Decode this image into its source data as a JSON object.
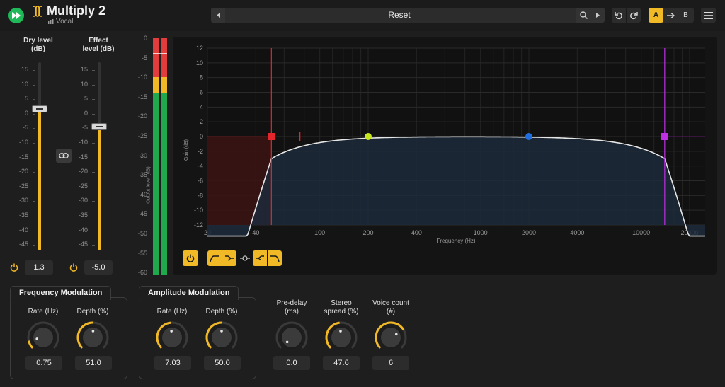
{
  "app": {
    "title": "Multiply 2",
    "preset_tag": "Vocal"
  },
  "preset": {
    "name": "Reset"
  },
  "ab": {
    "a_label": "A",
    "b_label": "B"
  },
  "levels": {
    "dry_title_1": "Dry level",
    "dry_title_2": "(dB)",
    "effect_title_1": "Effect",
    "effect_title_2": "level (dB)",
    "dry_value": "1.3",
    "effect_value": "-5.0",
    "ticks": [
      "15",
      "10",
      "5",
      "0",
      "-5",
      "-10",
      "-15",
      "-20",
      "-25",
      "-30",
      "-35",
      "-40",
      "-45"
    ]
  },
  "meter": {
    "label": "Output level (dB)",
    "ticks": [
      "0",
      "-5",
      "-10",
      "-15",
      "-20",
      "-25",
      "-30",
      "-35",
      "-40",
      "-45",
      "-50",
      "-55",
      "-60"
    ]
  },
  "eq": {
    "y_label": "Gain (dB)",
    "x_label": "Frequency (Hz)",
    "y_ticks": [
      "12",
      "10",
      "8",
      "6",
      "4",
      "2",
      "0",
      "-2",
      "-4",
      "-6",
      "-8",
      "-10",
      "-12"
    ],
    "x_ticks": [
      "20",
      "40",
      "100",
      "200",
      "400",
      "1000",
      "2000",
      "4000",
      "10000",
      "20000"
    ],
    "colors": {
      "low": "#e3262b",
      "mid1": "#c6e81c",
      "mid2": "#1f6fe0",
      "high": "#bf2fe6"
    }
  },
  "freq_mod": {
    "title": "Frequency Modulation",
    "rate_label": "Rate (Hz)",
    "rate_value": "0.75",
    "depth_label": "Depth (%)",
    "depth_value": "51.0"
  },
  "amp_mod": {
    "title": "Amplitude Modulation",
    "rate_label": "Rate (Hz)",
    "rate_value": "7.03",
    "depth_label": "Depth (%)",
    "depth_value": "50.0"
  },
  "misc": {
    "predelay_label_1": "Pre-delay",
    "predelay_label_2": "(ms)",
    "predelay_value": "0.0",
    "stereo_label_1": "Stereo",
    "stereo_label_2": "spread (%)",
    "stereo_value": "47.6",
    "voice_label_1": "Voice count",
    "voice_label_2": "(#)",
    "voice_value": "6"
  }
}
